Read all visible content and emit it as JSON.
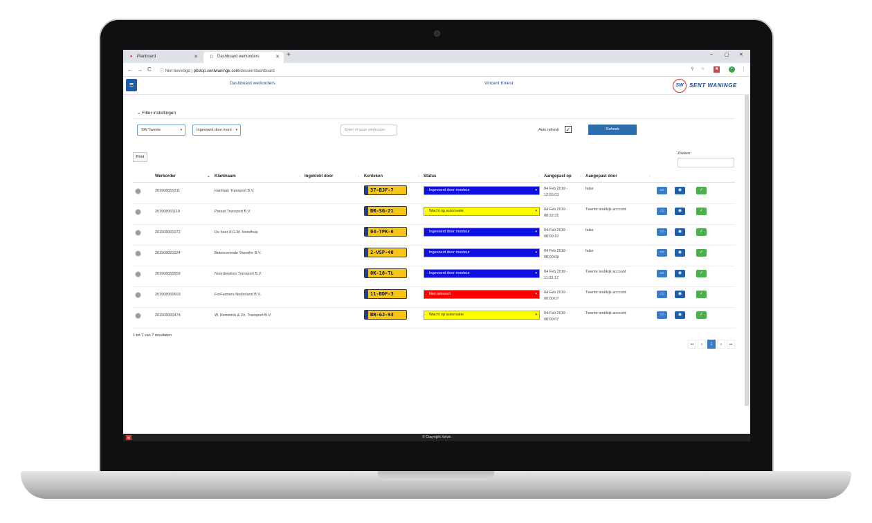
{
  "browser": {
    "tabs": [
      {
        "label": "Planboard",
        "icon": "planboard-favicon"
      },
      {
        "label": "Dashboard werkorders",
        "icon": "page-favicon"
      }
    ],
    "new_tab": "+",
    "window_controls": [
      "–",
      "▢",
      "✕"
    ],
    "nav": {
      "back": "←",
      "forward": "→",
      "reload": "C"
    },
    "security": "Niet beveiligd",
    "url_host": "pitstop.sentwaninge.com",
    "url_path": "/dossier/dashboard"
  },
  "appbar": {
    "menu": "≡",
    "title": "Dashboard werkorders",
    "user": "Vincent Kniest",
    "logo_badge": "SW",
    "logo_text": "SENT WANINGE"
  },
  "filters": {
    "heading": "Filter instellingen",
    "location": "SW Twente",
    "entered_by": "Ingevoerd door mont",
    "scan_placeholder": "Enter of scan werkorder",
    "auto_refresh_label": "Auto refresh",
    "auto_refresh_checked": "✓",
    "refresh_label": "Refresh"
  },
  "toolbar": {
    "print_label": "Print",
    "search_label": "Zoeken:"
  },
  "table": {
    "headers": [
      "Werkorder",
      "Klantnaam",
      "Ingeklokt door",
      "Kenteken",
      "Status",
      "Aangepast op",
      "Aangepast door"
    ],
    "rows": [
      {
        "werkorder": "201908001211",
        "klant": "Hartman Transport B.V.",
        "ingeklokt": "",
        "kenteken": "37-BJF-7",
        "status": "Ingevoerd door monteur",
        "status_color": "#1010e0",
        "status_text_color": "#ffffff",
        "date": "04 Feb 2019 -",
        "time": "12:55:03",
        "door": "false"
      },
      {
        "werkorder": "201908001119",
        "klant": "Paraat Transport B.V.",
        "ingeklokt": "",
        "kenteken": "BR-SG-21",
        "status": "Wacht op autorisatie",
        "status_color": "#ffff00",
        "status_text_color": "#222222",
        "date": "04 Feb 2019 -",
        "time": "08:32:31",
        "door": "Twente test/kijk account"
      },
      {
        "werkorder": "201908001072",
        "klant": "De heer A.G.M. Horsthuis",
        "ingeklokt": "",
        "kenteken": "04-TPK-6",
        "status": "Ingevoerd door monteur",
        "status_color": "#1010e0",
        "status_text_color": "#ffffff",
        "date": "04 Feb 2019 -",
        "time": "00:00:10",
        "door": "false"
      },
      {
        "werkorder": "201908001024",
        "klant": "Betoncentrale Twenthe B.V.",
        "ingeklokt": "",
        "kenteken": "2-VSP-40",
        "status": "Ingevoerd door monteur",
        "status_color": "#1010e0",
        "status_text_color": "#ffffff",
        "date": "04 Feb 2019 -",
        "time": "00:00:09",
        "door": "false"
      },
      {
        "werkorder": "201908000959",
        "klant": "Noordendorp Transport B.V.",
        "ingeklokt": "",
        "kenteken": "0K-18-TL",
        "status": "Ingevoerd door monteur",
        "status_color": "#1010e0",
        "status_text_color": "#ffffff",
        "date": "04 Feb 2019 -",
        "time": "11:33:17",
        "door": "Twente test/kijk account"
      },
      {
        "werkorder": "201908000603",
        "klant": "ForFarmers Nederland B.V.",
        "ingeklokt": "",
        "kenteken": "11-BDF-3",
        "status": "Niet akkoord",
        "status_color": "#ff0000",
        "status_text_color": "#ffffff",
        "date": "04 Feb 2019 -",
        "time": "00:00:07",
        "door": "Twente test/kijk account"
      },
      {
        "werkorder": "201908000474",
        "klant": "W. Remmink & Zn. Transport B.V.",
        "ingeklokt": "",
        "kenteken": "BR-GJ-93",
        "status": "Wacht op autorisatie",
        "status_color": "#ffff00",
        "status_text_color": "#222222",
        "date": "04 Feb 2019 -",
        "time": "00:00:07",
        "door": "Twente test/kijk account"
      }
    ]
  },
  "pagination": {
    "summary": "1 tot 7 van 7 resultaten",
    "first": "⏮",
    "prev": "«",
    "current": "1",
    "next": "»",
    "last": "⏭"
  },
  "footer": {
    "text": "© Copyright Xelvin",
    "badge": "93"
  }
}
